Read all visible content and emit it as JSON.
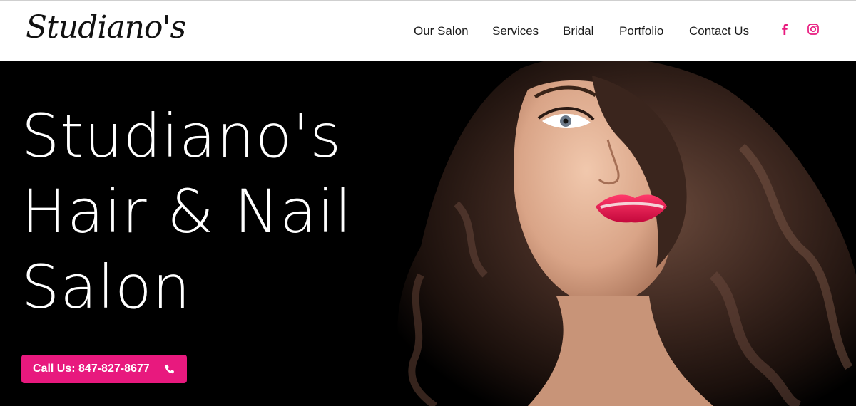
{
  "header": {
    "logo_text": "Studiano's",
    "nav": [
      {
        "label": "Our Salon"
      },
      {
        "label": "Services"
      },
      {
        "label": "Bridal"
      },
      {
        "label": "Portfolio"
      },
      {
        "label": "Contact Us"
      }
    ],
    "social": [
      {
        "icon": "facebook-icon",
        "color": "#e8197e"
      },
      {
        "icon": "instagram-icon",
        "color": "#e8197e"
      }
    ]
  },
  "hero": {
    "headline_lines": [
      "Studiano's",
      "Hair & Nail",
      "Salon"
    ],
    "cta_label": "Call Us: 847-827-8677",
    "cta_icon": "phone-icon",
    "accent_color": "#e8197e",
    "background_color": "#000000"
  }
}
